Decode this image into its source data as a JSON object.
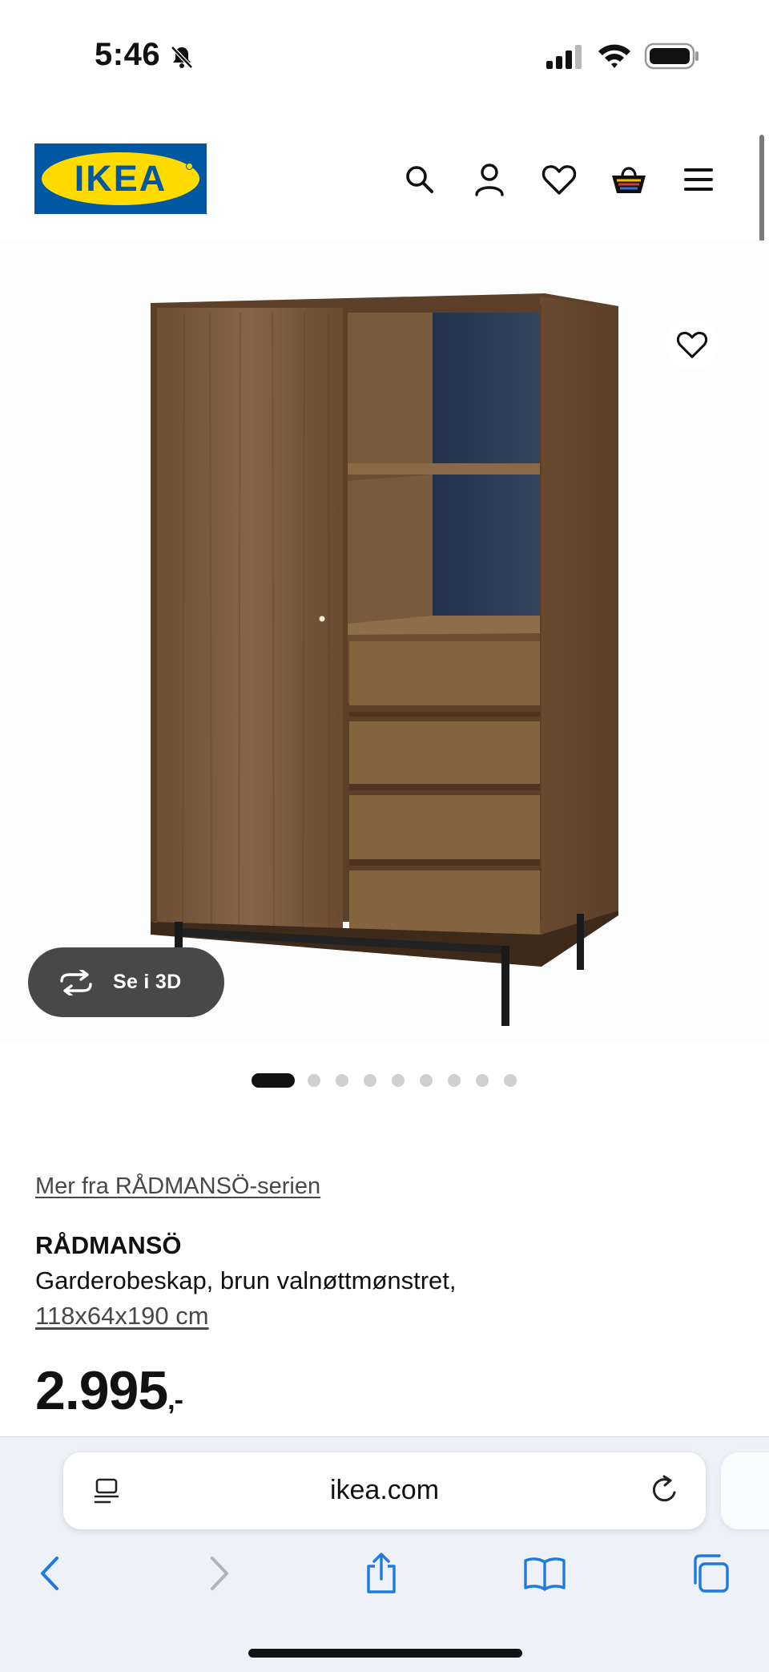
{
  "status_bar": {
    "time": "5:46"
  },
  "header": {
    "logo_text": "IKEA",
    "icons": [
      "search-icon",
      "account-icon",
      "heart-icon",
      "basket-icon",
      "menu-icon"
    ]
  },
  "gallery": {
    "view_3d_label": "Se i 3D",
    "dot_count": 9,
    "active_dot": 1
  },
  "product": {
    "series_link": "Mer fra RÅDMANSÖ-serien",
    "name": "RÅDMANSÖ",
    "description": "Garderobeskap, brun valnøttmønstret,",
    "size": "118x64x190 cm",
    "price_main": "2.995",
    "price_suffix": ",-"
  },
  "browser": {
    "url": "ikea.com"
  },
  "colors": {
    "ikea_blue": "#0058a3",
    "ikea_yellow": "#ffdb00",
    "wood": "#7a5a3c",
    "shelf_back": "#2c3a4e",
    "safari_blue": "#1f7ae0"
  }
}
